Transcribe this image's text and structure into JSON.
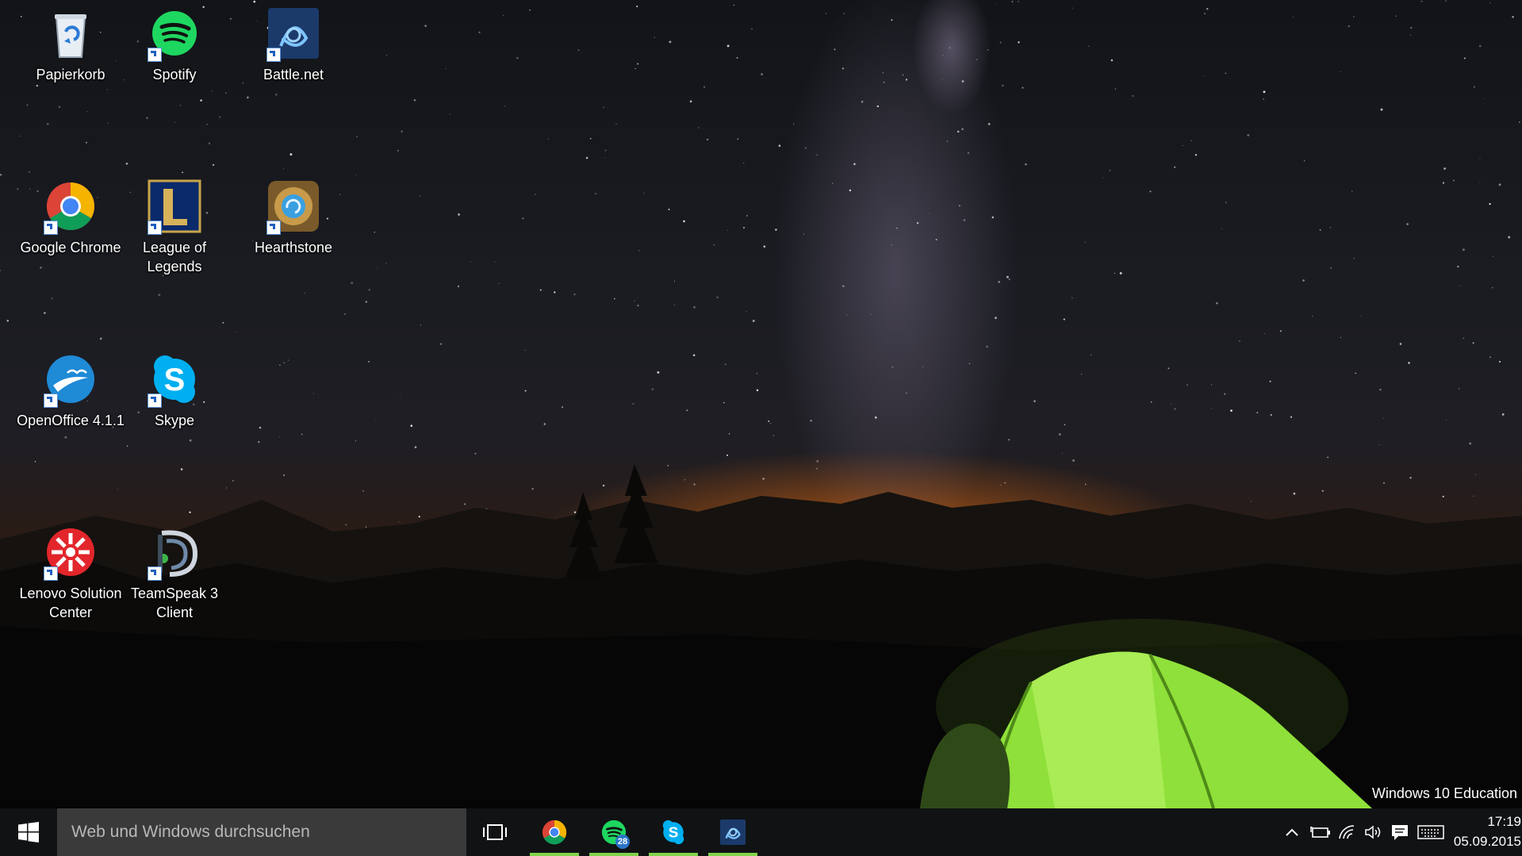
{
  "desktop": {
    "icons": [
      {
        "label": "Papierkorb",
        "icon": "recycle-bin-icon"
      },
      {
        "label": "Spotify",
        "icon": "spotify-icon"
      },
      {
        "label": "Battle.net",
        "icon": "battlenet-icon"
      },
      {
        "label": "Google Chrome",
        "icon": "chrome-icon"
      },
      {
        "label": "League of Legends",
        "icon": "league-of-legends-icon"
      },
      {
        "label": "Hearthstone",
        "icon": "hearthstone-icon"
      },
      {
        "label": "OpenOffice 4.1.1",
        "icon": "openoffice-icon"
      },
      {
        "label": "Skype",
        "icon": "skype-icon"
      },
      {
        "label": "Lenovo Solution Center",
        "icon": "lenovo-solution-center-icon"
      },
      {
        "label": "TeamSpeak 3 Client",
        "icon": "teamspeak-icon"
      }
    ],
    "edition_text": "Windows 10 Education"
  },
  "taskbar": {
    "start_icon": "windows-start-icon",
    "search_placeholder": "Web und Windows durchsuchen",
    "task_view_icon": "task-view-icon",
    "pinned": [
      {
        "app": "Google Chrome",
        "icon": "chrome-icon",
        "running": true
      },
      {
        "app": "Spotify",
        "icon": "spotify-icon",
        "running": true,
        "badge": "28"
      },
      {
        "app": "Skype",
        "icon": "skype-icon",
        "running": true
      },
      {
        "app": "Battle.net",
        "icon": "battlenet-icon",
        "running": true
      }
    ],
    "tray": {
      "icons": [
        "chevron-up-icon",
        "battery-icon",
        "wifi-icon",
        "volume-icon",
        "action-center-icon",
        "keyboard-icon"
      ]
    },
    "clock": {
      "time": "17:19",
      "date": "05.09.2015"
    }
  },
  "colors": {
    "taskbar_bg": "#101214",
    "search_bg": "#3a3a3a",
    "running_indicator": "#7fd34a",
    "tent_green": "#8fe03a"
  }
}
